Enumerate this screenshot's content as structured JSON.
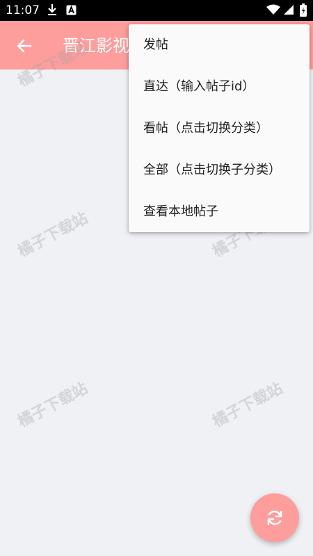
{
  "status_bar": {
    "time": "11:07",
    "icons": [
      "download-icon",
      "a-badge-icon",
      "wifi-icon",
      "signal-icon",
      "battery-charging-icon"
    ]
  },
  "app_bar": {
    "title": "晋江影视",
    "background": "#fd9d9c"
  },
  "menu": {
    "items": [
      {
        "label": "发帖"
      },
      {
        "label": "直达（输入帖子id）"
      },
      {
        "label": "看帖（点击切换分类）"
      },
      {
        "label": "全部（点击切换子分类）"
      },
      {
        "label": "查看本地帖子"
      }
    ]
  },
  "watermark": {
    "text": "橘子下载站"
  },
  "fab": {
    "icon": "refresh-icon",
    "color": "#fd9d9c"
  }
}
